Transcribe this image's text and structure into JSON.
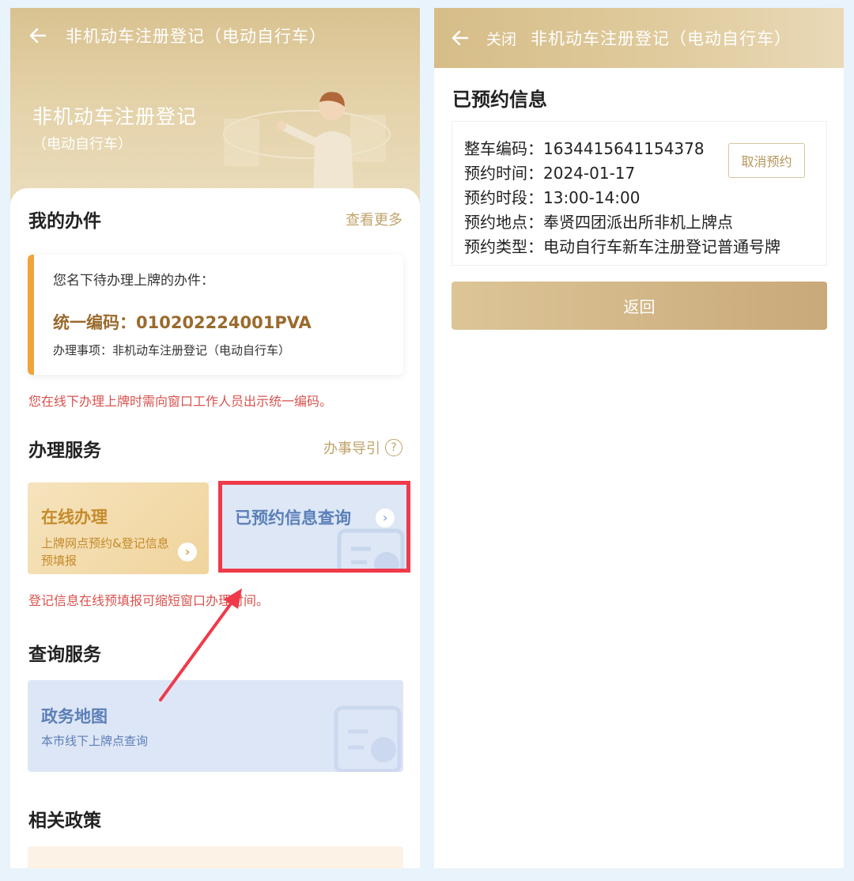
{
  "left": {
    "nav": {
      "back_icon": "arrow-left-icon",
      "title": "非机动车注册登记（电动自行车）"
    },
    "hero": {
      "title": "非机动车注册登记",
      "subtitle": "（电动自行车）"
    },
    "my_items": {
      "title": "我的办件",
      "more": "查看更多",
      "card": {
        "intro": "您名下待办理上牌的办件：",
        "code_line": "统一编码：010202224001PVA",
        "matter": "办理事项：非机动车注册登记（电动自行车）"
      },
      "hint": "您在线下办理上牌时需向窗口工作人员出示统一编码。"
    },
    "services": {
      "title": "办理服务",
      "guide": "办事导引",
      "online": {
        "title": "在线办理",
        "desc": "上牌网点预约&登记信息预填报"
      },
      "appointment": {
        "title": "已预约信息查询"
      },
      "hint": "登记信息在线预填报可缩短窗口办理时间。"
    },
    "query": {
      "title": "查询服务",
      "map": {
        "title": "政务地图",
        "desc": "本市线下上牌点查询"
      }
    },
    "policy": {
      "title": "相关政策"
    }
  },
  "right": {
    "nav": {
      "back_icon": "arrow-left-icon",
      "close": "关闭",
      "title": "非机动车注册登记（电动自行车）"
    },
    "heading": "已预约信息",
    "rows": [
      "整车编码：1634415641154378",
      "预约时间：2024-01-17",
      "预约时段：13:00-14:00",
      "预约地点：奉贤四团派出所非机上牌点",
      "预约类型：电动自行车新车注册登记普通号牌"
    ],
    "cancel": "取消预约",
    "return": "返回"
  },
  "colors": {
    "gold": "#d6bd88",
    "accent_red": "#ef3a4a",
    "hint_red": "#d9534f",
    "blue": "#5b7fb8"
  }
}
